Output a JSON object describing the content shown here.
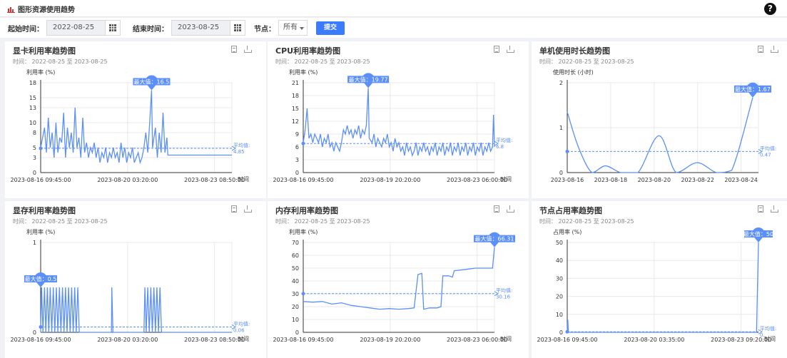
{
  "header": {
    "title": "图形资源使用趋势",
    "help": "?"
  },
  "filters": {
    "start_label": "起始时间：",
    "start_value": "2022-08-25",
    "end_label": "结束时间：",
    "end_value": "2023-08-25",
    "node_label": "节点：",
    "node_value": "所有",
    "submit_label": "提交"
  },
  "colors": {
    "line": "#5b8ff9",
    "accent": "#3a7bff",
    "grid": "#e8e8e8"
  },
  "panels": [
    {
      "title": "显卡利用率趋势图",
      "time": "时间：  2022-08-25 至 2023-08-25",
      "chart_data": {
        "type": "line",
        "ylabel": "利用率 (%)",
        "xlabel": "时间",
        "ylim": [
          0,
          18
        ],
        "yticks": [
          0,
          3,
          5,
          8,
          10,
          13,
          15,
          18
        ],
        "xticks": [
          "2023-08-16 09:45:00",
          "2023-08-20 03:20:00",
          "2023-08-23 08:50:00"
        ],
        "max_label": "最大值：16.5",
        "max_value": 16.5,
        "max_pos": 0.58,
        "avg_label": "平均值:",
        "avg_value": "4.85",
        "avg": 4.85,
        "smooth": false,
        "points": [
          [
            0.0,
            5
          ],
          [
            0.01,
            7
          ],
          [
            0.02,
            9
          ],
          [
            0.03,
            4
          ],
          [
            0.04,
            11
          ],
          [
            0.05,
            5
          ],
          [
            0.06,
            8
          ],
          [
            0.07,
            3
          ],
          [
            0.08,
            10
          ],
          [
            0.09,
            4
          ],
          [
            0.1,
            7
          ],
          [
            0.11,
            6
          ],
          [
            0.12,
            12
          ],
          [
            0.13,
            3
          ],
          [
            0.14,
            9
          ],
          [
            0.15,
            5
          ],
          [
            0.16,
            8
          ],
          [
            0.17,
            4
          ],
          [
            0.18,
            13
          ],
          [
            0.19,
            5
          ],
          [
            0.2,
            7
          ],
          [
            0.21,
            3
          ],
          [
            0.22,
            11
          ],
          [
            0.23,
            4
          ],
          [
            0.24,
            6
          ],
          [
            0.25,
            3
          ],
          [
            0.26,
            5
          ],
          [
            0.27,
            4
          ],
          [
            0.28,
            6
          ],
          [
            0.29,
            3
          ],
          [
            0.3,
            5
          ],
          [
            0.31,
            2
          ],
          [
            0.32,
            4
          ],
          [
            0.33,
            3
          ],
          [
            0.34,
            5
          ],
          [
            0.35,
            2
          ],
          [
            0.36,
            4
          ],
          [
            0.37,
            3
          ],
          [
            0.38,
            5
          ],
          [
            0.39,
            3
          ],
          [
            0.4,
            4
          ],
          [
            0.41,
            2
          ],
          [
            0.42,
            6
          ],
          [
            0.43,
            3
          ],
          [
            0.44,
            5
          ],
          [
            0.45,
            2
          ],
          [
            0.46,
            4
          ],
          [
            0.47,
            3
          ],
          [
            0.48,
            5
          ],
          [
            0.49,
            2
          ],
          [
            0.5,
            3
          ],
          [
            0.51,
            4
          ],
          [
            0.52,
            2
          ],
          [
            0.53,
            3
          ],
          [
            0.54,
            5
          ],
          [
            0.55,
            8
          ],
          [
            0.56,
            4
          ],
          [
            0.57,
            10
          ],
          [
            0.58,
            16.5
          ],
          [
            0.585,
            5
          ],
          [
            0.6,
            9
          ],
          [
            0.61,
            3
          ],
          [
            0.62,
            8
          ],
          [
            0.63,
            4
          ],
          [
            0.64,
            12
          ],
          [
            0.65,
            4
          ],
          [
            0.66,
            7
          ],
          [
            0.665,
            3.5
          ],
          [
            1.0,
            3.5
          ]
        ]
      }
    },
    {
      "title": "CPU利用率趋势图",
      "time": "时间：  2022-08-25 至 2023-08-25",
      "chart_data": {
        "type": "line",
        "ylabel": "利用率 (%)",
        "xlabel": "时间",
        "ylim": [
          0,
          21
        ],
        "yticks": [
          0,
          3,
          6,
          9,
          12,
          15,
          18,
          21
        ],
        "xticks": [
          "2023-08-16 09:45:00",
          "2023-08-19 20:20:00",
          "2023-08-23 06:00:00"
        ],
        "max_label": "最大值：19.77",
        "max_value": 19.77,
        "max_pos": 0.34,
        "avg_label": "平均值:",
        "avg_value": "6.8",
        "avg": 6.8,
        "smooth": false,
        "points": [
          [
            0.0,
            7
          ],
          [
            0.01,
            10
          ],
          [
            0.02,
            15
          ],
          [
            0.03,
            8
          ],
          [
            0.04,
            9
          ],
          [
            0.05,
            7
          ],
          [
            0.06,
            9
          ],
          [
            0.07,
            8
          ],
          [
            0.08,
            7
          ],
          [
            0.09,
            9
          ],
          [
            0.1,
            6
          ],
          [
            0.11,
            8
          ],
          [
            0.12,
            7
          ],
          [
            0.13,
            9
          ],
          [
            0.14,
            6
          ],
          [
            0.15,
            7
          ],
          [
            0.16,
            5
          ],
          [
            0.17,
            7
          ],
          [
            0.18,
            6
          ],
          [
            0.19,
            5
          ],
          [
            0.2,
            7
          ],
          [
            0.21,
            10
          ],
          [
            0.22,
            9
          ],
          [
            0.23,
            11
          ],
          [
            0.24,
            9
          ],
          [
            0.25,
            10
          ],
          [
            0.26,
            8
          ],
          [
            0.27,
            10
          ],
          [
            0.28,
            9
          ],
          [
            0.29,
            11
          ],
          [
            0.3,
            8
          ],
          [
            0.31,
            10
          ],
          [
            0.32,
            9
          ],
          [
            0.33,
            11
          ],
          [
            0.34,
            19.77
          ],
          [
            0.345,
            8
          ],
          [
            0.36,
            7
          ],
          [
            0.37,
            9
          ],
          [
            0.38,
            6
          ],
          [
            0.39,
            8
          ],
          [
            0.4,
            7
          ],
          [
            0.41,
            6
          ],
          [
            0.42,
            8
          ],
          [
            0.43,
            7
          ],
          [
            0.44,
            9
          ],
          [
            0.45,
            6
          ],
          [
            0.46,
            7
          ],
          [
            0.47,
            5
          ],
          [
            0.48,
            8
          ],
          [
            0.49,
            6
          ],
          [
            0.5,
            7
          ],
          [
            0.51,
            5
          ],
          [
            0.52,
            6
          ],
          [
            0.53,
            4
          ],
          [
            0.54,
            7
          ],
          [
            0.55,
            5
          ],
          [
            0.56,
            6
          ],
          [
            0.57,
            4
          ],
          [
            0.58,
            5
          ],
          [
            0.59,
            7
          ],
          [
            0.6,
            4
          ],
          [
            0.61,
            6
          ],
          [
            0.62,
            5
          ],
          [
            0.63,
            7
          ],
          [
            0.64,
            5
          ],
          [
            0.65,
            6
          ],
          [
            0.66,
            4
          ],
          [
            0.67,
            6
          ],
          [
            0.68,
            5
          ],
          [
            0.69,
            7
          ],
          [
            0.7,
            4
          ],
          [
            0.71,
            6
          ],
          [
            0.72,
            5
          ],
          [
            0.73,
            7
          ],
          [
            0.74,
            4
          ],
          [
            0.75,
            6
          ],
          [
            0.76,
            5
          ],
          [
            0.77,
            7
          ],
          [
            0.78,
            4
          ],
          [
            0.79,
            6
          ],
          [
            0.8,
            5
          ],
          [
            0.81,
            7
          ],
          [
            0.82,
            4
          ],
          [
            0.83,
            6
          ],
          [
            0.84,
            5
          ],
          [
            0.85,
            7
          ],
          [
            0.86,
            4
          ],
          [
            0.87,
            6
          ],
          [
            0.88,
            5
          ],
          [
            0.89,
            7
          ],
          [
            0.9,
            4
          ],
          [
            0.91,
            6
          ],
          [
            0.92,
            5
          ],
          [
            0.93,
            7
          ],
          [
            0.94,
            4
          ],
          [
            0.95,
            6
          ],
          [
            0.96,
            5
          ],
          [
            0.97,
            7
          ],
          [
            0.98,
            5
          ],
          [
            0.99,
            6
          ],
          [
            0.995,
            13.5
          ],
          [
            1.0,
            6
          ]
        ]
      }
    },
    {
      "title": "单机使用时长趋势图",
      "time": "时间：  2022-08-25 至 2023-08-25",
      "chart_data": {
        "type": "line",
        "ylabel": "使用时长 (小时)",
        "xlabel": "",
        "ylim": [
          0,
          2
        ],
        "yticks": [
          0,
          1,
          2
        ],
        "xticks": [
          "2023-08-16",
          "2023-08-18",
          "2023-08-20",
          "2023-08-22",
          "2023-08-24"
        ],
        "max_label": "最大值：1.67",
        "max_value": 1.67,
        "max_pos": 0.97,
        "avg_label": "平均值:",
        "avg_value": "0.47",
        "avg": 0.47,
        "smooth": true,
        "points": [
          [
            0.0,
            1.35
          ],
          [
            0.06,
            0.55
          ],
          [
            0.13,
            0.0
          ],
          [
            0.2,
            0.15
          ],
          [
            0.28,
            0.0
          ],
          [
            0.37,
            0.0
          ],
          [
            0.48,
            0.82
          ],
          [
            0.57,
            0.0
          ],
          [
            0.68,
            0.22
          ],
          [
            0.78,
            0.0
          ],
          [
            0.86,
            0.05
          ],
          [
            0.97,
            1.67
          ]
        ]
      }
    },
    {
      "title": "显存利用率趋势图",
      "time": "时间：  2022-08-25 至 2023-08-25",
      "chart_data": {
        "type": "line",
        "ylabel": "利用率 (%)",
        "xlabel": "时间",
        "ylim": [
          0,
          1
        ],
        "yticks": [
          0,
          1
        ],
        "xticks": [
          "2023-08-16 09:45:00",
          "2023-08-20 03:20:00",
          "2023-08-23 08:50:00"
        ],
        "max_label": "最大值：0.5",
        "max_value": 0.5,
        "max_pos": 0.0,
        "avg_label": "平均值:",
        "avg_value": "0.06",
        "avg": 0.06,
        "smooth": false,
        "points": [
          [
            0.0,
            0
          ],
          [
            0.005,
            0.5
          ],
          [
            0.012,
            0
          ],
          [
            0.02,
            0.5
          ],
          [
            0.027,
            0
          ],
          [
            0.035,
            0.5
          ],
          [
            0.042,
            0
          ],
          [
            0.05,
            0.5
          ],
          [
            0.058,
            0
          ],
          [
            0.066,
            0.5
          ],
          [
            0.074,
            0
          ],
          [
            0.082,
            0.5
          ],
          [
            0.09,
            0
          ],
          [
            0.098,
            0.5
          ],
          [
            0.106,
            0
          ],
          [
            0.114,
            0.5
          ],
          [
            0.122,
            0
          ],
          [
            0.13,
            0.5
          ],
          [
            0.138,
            0
          ],
          [
            0.146,
            0.5
          ],
          [
            0.154,
            0
          ],
          [
            0.162,
            0.5
          ],
          [
            0.17,
            0
          ],
          [
            0.178,
            0.5
          ],
          [
            0.186,
            0
          ],
          [
            0.194,
            0.5
          ],
          [
            0.202,
            0
          ],
          [
            0.37,
            0
          ],
          [
            0.372,
            0.5
          ],
          [
            0.378,
            0
          ],
          [
            0.54,
            0
          ],
          [
            0.545,
            0.5
          ],
          [
            0.552,
            0
          ],
          [
            0.56,
            0.5
          ],
          [
            0.568,
            0
          ],
          [
            0.576,
            0.5
          ],
          [
            0.584,
            0
          ],
          [
            0.592,
            0.5
          ],
          [
            0.6,
            0
          ],
          [
            0.608,
            0.5
          ],
          [
            0.616,
            0
          ],
          [
            0.624,
            0.5
          ],
          [
            0.632,
            0
          ],
          [
            1.0,
            0
          ]
        ]
      }
    },
    {
      "title": "内存利用率趋势图",
      "time": "时间：  2022-08-25 至 2023-08-25",
      "chart_data": {
        "type": "line",
        "ylabel": "利用率 (%)",
        "xlabel": "时间",
        "ylim": [
          0,
          70
        ],
        "yticks": [
          0,
          10,
          20,
          30,
          40,
          50,
          60,
          70
        ],
        "xticks": [
          "2023-08-16 09:45:00",
          "2023-08-19 20:20:00",
          "2023-08-23 06:00:00"
        ],
        "max_label": "最大值：66.31",
        "max_value": 66.31,
        "max_pos": 1.0,
        "avg_label": "平均值:",
        "avg_value": "30.16",
        "avg": 30.16,
        "smooth": false,
        "points": [
          [
            0.0,
            24
          ],
          [
            0.05,
            23.5
          ],
          [
            0.1,
            24
          ],
          [
            0.15,
            22
          ],
          [
            0.2,
            23
          ],
          [
            0.25,
            21
          ],
          [
            0.3,
            20
          ],
          [
            0.35,
            19
          ],
          [
            0.4,
            18
          ],
          [
            0.45,
            18.5
          ],
          [
            0.5,
            18
          ],
          [
            0.55,
            18.5
          ],
          [
            0.58,
            19
          ],
          [
            0.6,
            45
          ],
          [
            0.62,
            46
          ],
          [
            0.63,
            18
          ],
          [
            0.66,
            19
          ],
          [
            0.7,
            19
          ],
          [
            0.72,
            20
          ],
          [
            0.73,
            44
          ],
          [
            0.76,
            44
          ],
          [
            0.78,
            43
          ],
          [
            0.79,
            48
          ],
          [
            0.85,
            49
          ],
          [
            0.9,
            50
          ],
          [
            0.95,
            50
          ],
          [
            0.99,
            50
          ],
          [
            1.0,
            66.31
          ]
        ]
      }
    },
    {
      "title": "节点占用率趋势图",
      "time": "时间：  2022-08-25 至 2023-08-25",
      "chart_data": {
        "type": "line",
        "ylabel": "占用率 (%)",
        "xlabel": "时间",
        "ylim": [
          0,
          50
        ],
        "yticks": [
          0,
          10,
          20,
          30,
          40,
          50
        ],
        "xticks": [
          "2023-08-16 09:45:00",
          "2023-08-20 03:35:00",
          "2023-08-23 09:20:00"
        ],
        "max_label": "最大值：50",
        "max_value": 50,
        "max_pos": 1.0,
        "avg_label": "平均值:",
        "avg_value": "0.",
        "avg": 0.3,
        "smooth": false,
        "points": [
          [
            0.0,
            0
          ],
          [
            0.003,
            7
          ],
          [
            0.006,
            0
          ],
          [
            0.99,
            0
          ],
          [
            1.0,
            50
          ]
        ]
      }
    }
  ]
}
